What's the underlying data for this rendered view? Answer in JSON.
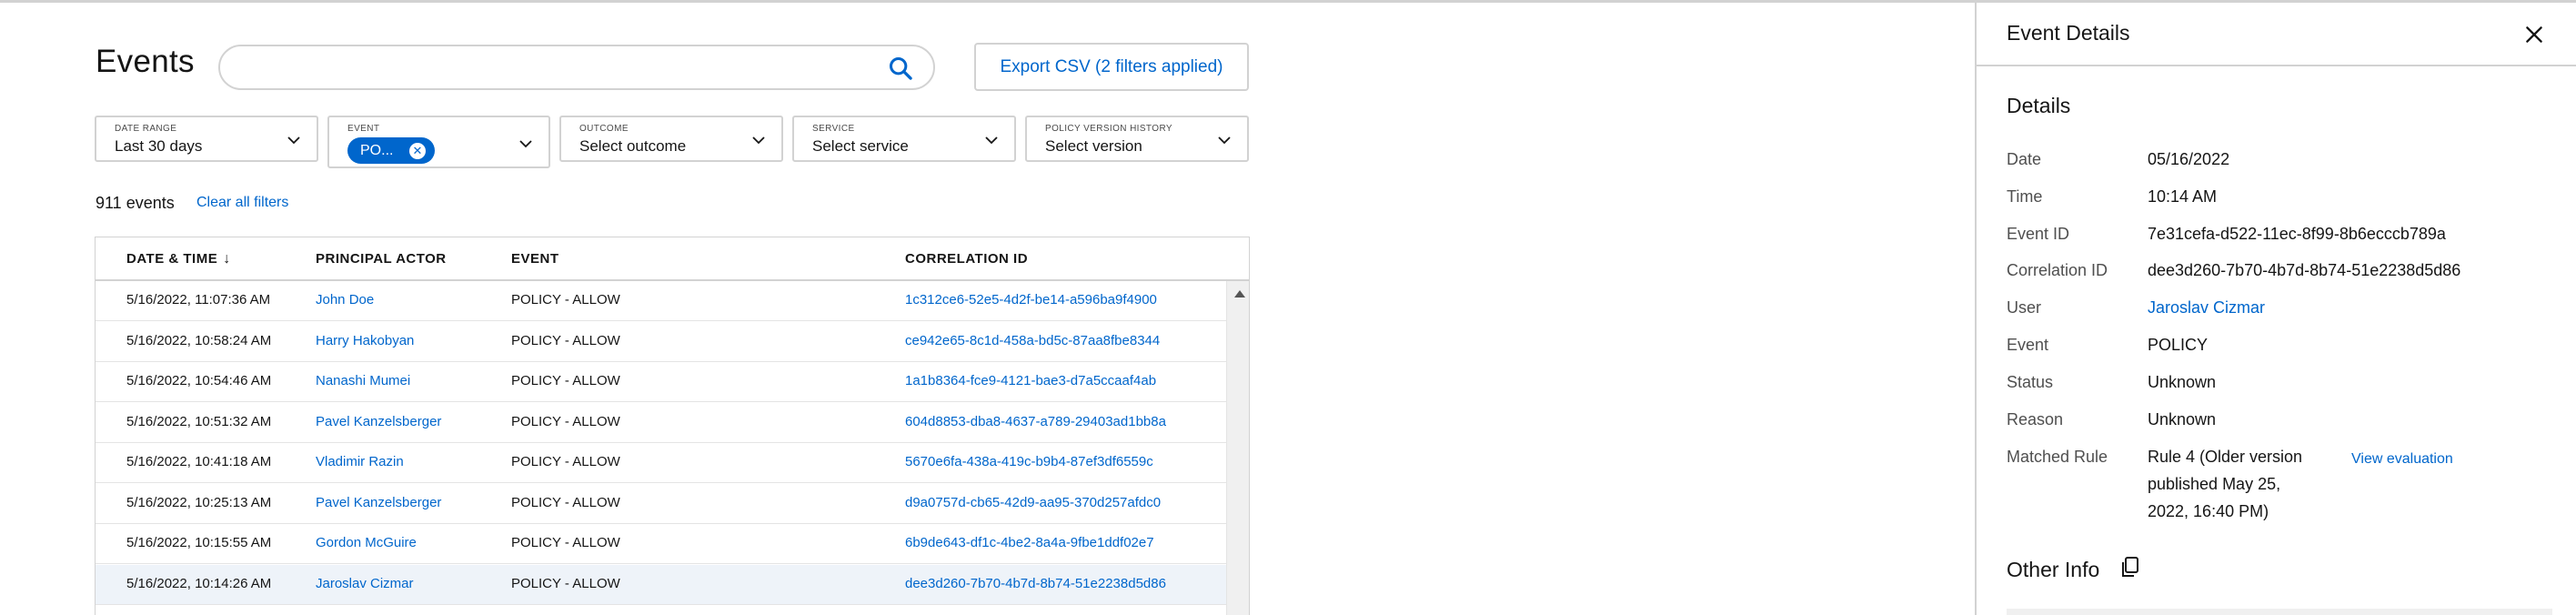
{
  "page": {
    "title": "Events",
    "export_label": "Export CSV (2 filters applied)",
    "search": {
      "placeholder": "",
      "value": ""
    }
  },
  "filters": [
    {
      "label": "DATE RANGE",
      "value": "Last 30 days"
    },
    {
      "label": "EVENT",
      "chip": "PO..."
    },
    {
      "label": "OUTCOME",
      "value": "Select outcome"
    },
    {
      "label": "SERVICE",
      "value": "Select service"
    },
    {
      "label": "POLICY VERSION HISTORY",
      "value": "Select version"
    }
  ],
  "results": {
    "count": "911 events",
    "clear_label": "Clear all filters"
  },
  "table": {
    "columns": [
      "DATE & TIME",
      "PRINCIPAL ACTOR",
      "EVENT",
      "CORRELATION ID"
    ],
    "rows": [
      {
        "datetime": "5/16/2022, 11:07:36 AM",
        "actor": "John Doe",
        "event": "POLICY - ALLOW",
        "correlation": "1c312ce6-52e5-4d2f-be14-a596ba9f4900"
      },
      {
        "datetime": "5/16/2022, 10:58:24 AM",
        "actor": "Harry Hakobyan",
        "event": "POLICY - ALLOW",
        "correlation": "ce942e65-8c1d-458a-bd5c-87aa8fbe8344"
      },
      {
        "datetime": "5/16/2022, 10:54:46 AM",
        "actor": "Nanashi Mumei",
        "event": "POLICY - ALLOW",
        "correlation": "1a1b8364-fce9-4121-bae3-d7a5ccaaf4ab"
      },
      {
        "datetime": "5/16/2022, 10:51:32 AM",
        "actor": "Pavel Kanzelsberger",
        "event": "POLICY - ALLOW",
        "correlation": "604d8853-dba8-4637-a789-29403ad1bb8a"
      },
      {
        "datetime": "5/16/2022, 10:41:18 AM",
        "actor": "Vladimir Razin",
        "event": "POLICY - ALLOW",
        "correlation": "5670e6fa-438a-419c-b9b4-87ef3df6559c"
      },
      {
        "datetime": "5/16/2022, 10:25:13 AM",
        "actor": "Pavel Kanzelsberger",
        "event": "POLICY - ALLOW",
        "correlation": "d9a0757d-cb65-42d9-aa95-370d257afdc0"
      },
      {
        "datetime": "5/16/2022, 10:15:55 AM",
        "actor": "Gordon McGuire",
        "event": "POLICY - ALLOW",
        "correlation": "6b9de643-df1c-4be2-8a4a-9fbe1ddf02e7"
      },
      {
        "datetime": "5/16/2022, 10:14:26 AM",
        "actor": "Jaroslav Cizmar",
        "event": "POLICY - ALLOW",
        "correlation": "dee3d260-7b70-4b7d-8b74-51e2238d5d86"
      }
    ],
    "selected_index": 7
  },
  "drawer": {
    "title": "Event Details",
    "details_title": "Details",
    "fields": [
      {
        "label": "Date",
        "value": "05/16/2022"
      },
      {
        "label": "Time",
        "value": "10:14 AM"
      },
      {
        "label": "Event ID",
        "value": "7e31cefa-d522-11ec-8f99-8b6ecccb789a"
      },
      {
        "label": "Correlation ID",
        "value": "dee3d260-7b70-4b7d-8b74-51e2238d5d86"
      },
      {
        "label": "User",
        "value": "Jaroslav Cizmar"
      },
      {
        "label": "Event",
        "value": "POLICY"
      },
      {
        "label": "Status",
        "value": "Unknown"
      },
      {
        "label": "Reason",
        "value": "Unknown"
      }
    ],
    "matched_rule": {
      "label": "Matched Rule",
      "lines": [
        "Rule 4 (Older version",
        "published May 25,",
        "2022, 16:40 PM)"
      ],
      "link": "View evaluation"
    },
    "other_title": "Other Info"
  },
  "colors": {
    "link": "#0066cc",
    "chip": "#0066cc",
    "selected_row": "#eef3f9",
    "border": "#d2d2d2"
  }
}
